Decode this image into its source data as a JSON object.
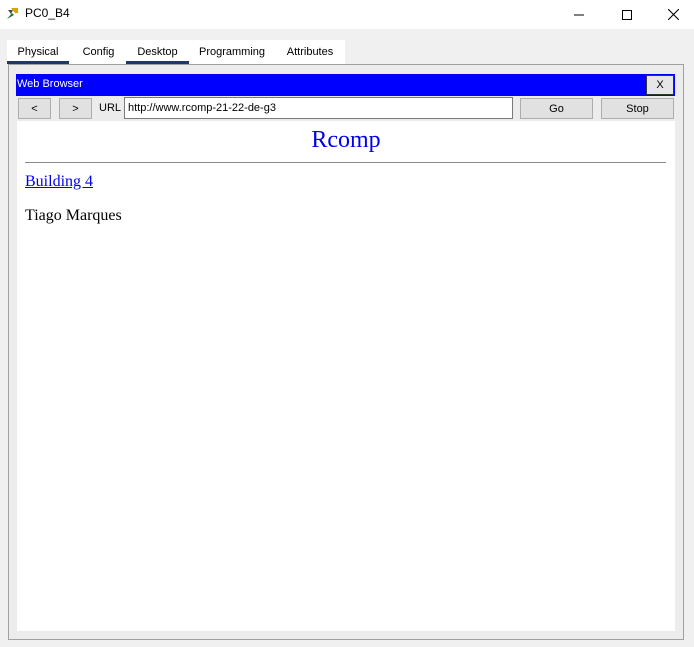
{
  "window": {
    "title": "PC0_B4",
    "icon": "packet-tracer-pc-icon"
  },
  "tabs": [
    {
      "label": "Physical",
      "active": false
    },
    {
      "label": "Config",
      "active": false
    },
    {
      "label": "Desktop",
      "active": true
    },
    {
      "label": "Programming",
      "active": false
    },
    {
      "label": "Attributes",
      "active": false
    }
  ],
  "browser": {
    "title": "Web Browser",
    "close_label": "X",
    "back_label": "<",
    "forward_label": ">",
    "url_label": "URL",
    "url_value": "http://www.rcomp-21-22-de-g3",
    "go_label": "Go",
    "stop_label": "Stop",
    "header_color": "#0000ff"
  },
  "page": {
    "heading": "Rcomp",
    "link_text": "Building 4",
    "body_text": "Tiago Marques",
    "link_color": "#0000ee"
  }
}
